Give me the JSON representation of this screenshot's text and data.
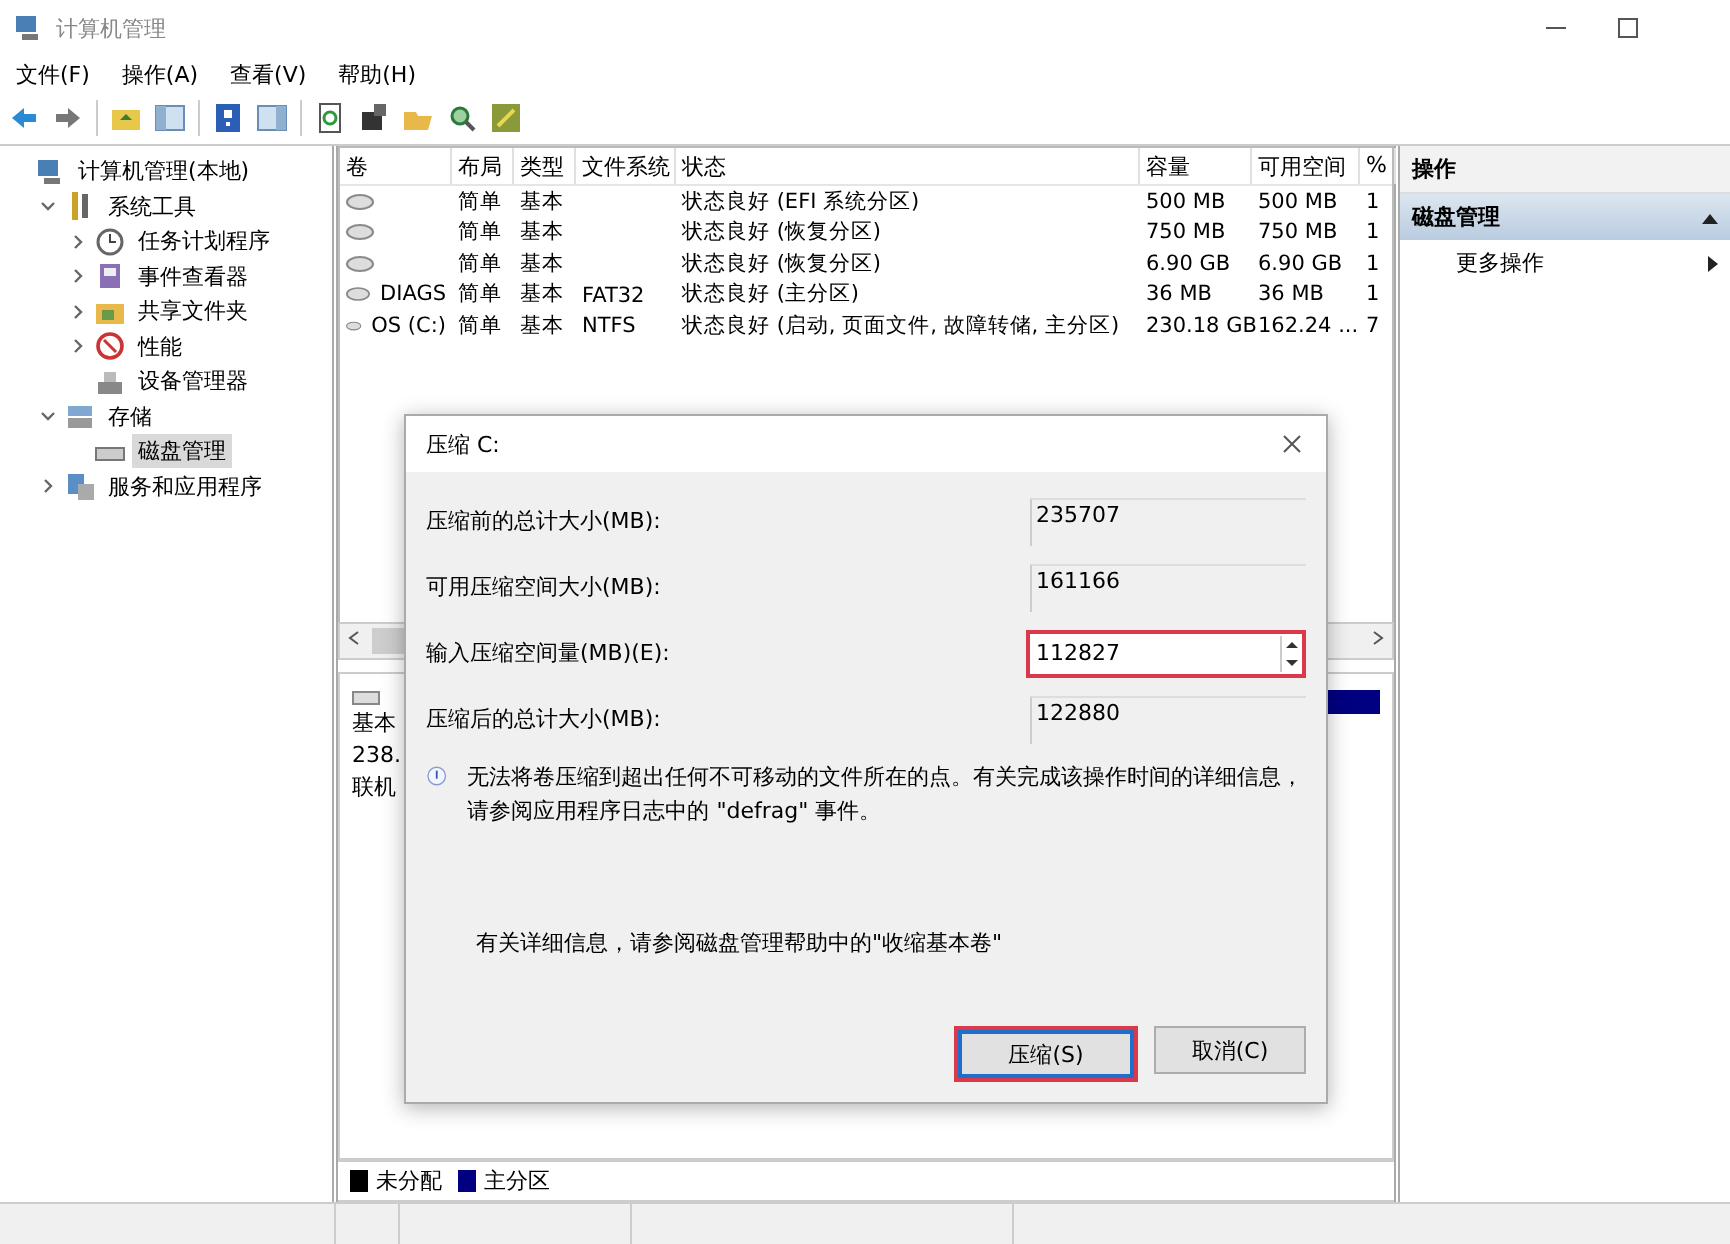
{
  "window": {
    "title": "计算机管理"
  },
  "menu": [
    "文件(F)",
    "操作(A)",
    "查看(V)",
    "帮助(H)"
  ],
  "tree": [
    {
      "label": "计算机管理(本地)",
      "kind": "root",
      "selected": false,
      "children": [
        {
          "label": "系统工具",
          "kind": "branch",
          "expanded": true,
          "selected": false,
          "children": [
            {
              "label": "任务计划程序",
              "kind": "branch",
              "expanded": false,
              "selected": false
            },
            {
              "label": "事件查看器",
              "kind": "branch",
              "expanded": false,
              "selected": false
            },
            {
              "label": "共享文件夹",
              "kind": "branch",
              "expanded": false,
              "selected": false
            },
            {
              "label": "性能",
              "kind": "branch",
              "expanded": false,
              "selected": false
            },
            {
              "label": "设备管理器",
              "kind": "leaf",
              "selected": false
            }
          ]
        },
        {
          "label": "存储",
          "kind": "branch",
          "expanded": true,
          "selected": false,
          "children": [
            {
              "label": "磁盘管理",
              "kind": "leaf",
              "selected": true
            }
          ]
        },
        {
          "label": "服务和应用程序",
          "kind": "branch",
          "expanded": false,
          "selected": false
        }
      ]
    }
  ],
  "table": {
    "columns": [
      "卷",
      "布局",
      "类型",
      "文件系统",
      "状态",
      "容量",
      "可用空间",
      "%"
    ],
    "rows": [
      {
        "layout": "简单",
        "type": "基本",
        "status": "状态良好 (EFI 系统分区)",
        "capacity": "500 MB",
        "free": "500 MB",
        "pct": "1"
      },
      {
        "layout": "简单",
        "type": "基本",
        "status": "状态良好 (恢复分区)",
        "capacity": "750 MB",
        "free": "750 MB",
        "pct": "1"
      },
      {
        "layout": "简单",
        "type": "基本",
        "status": "状态良好 (恢复分区)",
        "capacity": "6.90 GB",
        "free": "6.90 GB",
        "pct": "1"
      },
      {
        "volume": "DIAGS",
        "layout": "简单",
        "type": "基本",
        "fs": "FAT32",
        "status": "状态良好 (主分区)",
        "capacity": "36 MB",
        "free": "36 MB",
        "pct": "1"
      },
      {
        "volume": "OS (C:)",
        "layout": "简单",
        "type": "基本",
        "fs": "NTFS",
        "status": "状态良好 (启动, 页面文件, 故障转储, 主分区)",
        "capacity": "230.18 GB",
        "free": "162.24 ...",
        "pct": "7"
      }
    ]
  },
  "disk_panel": {
    "lines": [
      "基本",
      "238.",
      "联机"
    ]
  },
  "legend": [
    {
      "label": "未分配",
      "color": "#000000"
    },
    {
      "label": "主分区",
      "color": "#000080"
    }
  ],
  "actions": {
    "title": "操作",
    "section": {
      "label": "磁盘管理",
      "expanded": true
    },
    "items": [
      "更多操作"
    ]
  },
  "dialog": {
    "title": "压缩 C:",
    "fields": [
      {
        "label": "压缩前的总计大小(MB):",
        "value": "235707",
        "kind": "readonly",
        "highlighted": false
      },
      {
        "label": "可用压缩空间大小(MB):",
        "value": "161166",
        "kind": "readonly",
        "highlighted": false
      },
      {
        "label": "输入压缩空间量(MB)(E):",
        "value": "112827",
        "kind": "spin",
        "highlighted": true
      },
      {
        "label": "压缩后的总计大小(MB):",
        "value": "122880",
        "kind": "readonly",
        "highlighted": false
      }
    ],
    "info": "无法将卷压缩到超出任何不可移动的文件所在的点。有关完成该操作时间的详细信息，请参阅应用程序日志中的 \"defrag\" 事件。",
    "help": "有关详细信息，请参阅磁盘管理帮助中的\"收缩基本卷\"",
    "buttons": [
      {
        "label": "压缩(S)",
        "highlighted": true
      },
      {
        "label": "取消(C)",
        "highlighted": false
      }
    ]
  }
}
